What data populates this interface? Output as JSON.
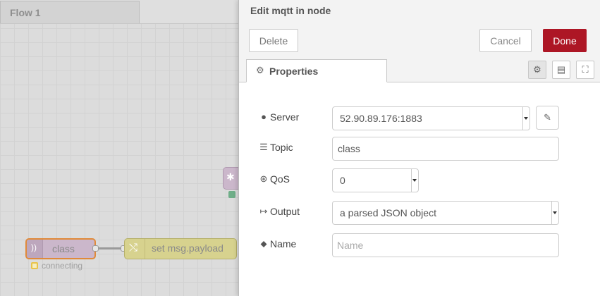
{
  "workspace": {
    "flow_tab_label": "Flow 1",
    "nodes": {
      "mqtt_in": {
        "label": "class",
        "status": "connecting"
      },
      "change": {
        "label": "set msg.payload"
      }
    }
  },
  "panel": {
    "title": "Edit mqtt in node",
    "buttons": {
      "delete": "Delete",
      "cancel": "Cancel",
      "done": "Done"
    },
    "tabs": {
      "properties": "Properties"
    },
    "fields": {
      "server": {
        "label": "Server",
        "value": "52.90.89.176:1883"
      },
      "topic": {
        "label": "Topic",
        "value": "class"
      },
      "qos": {
        "label": "QoS",
        "value": "0"
      },
      "output": {
        "label": "Output",
        "value": "a parsed JSON object"
      },
      "name": {
        "label": "Name",
        "value": "",
        "placeholder": "Name"
      }
    }
  },
  "colors": {
    "done_button": "#ad1625",
    "mqtt_node": "#cbb7cb",
    "change_node": "#d7d28e",
    "selected_outline": "#e08a3a"
  }
}
